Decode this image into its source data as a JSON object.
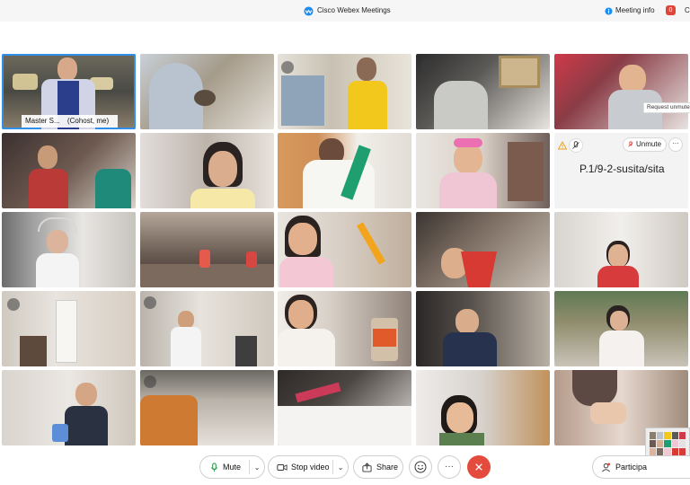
{
  "window": {
    "title": "Cisco Webex Meetings",
    "meeting_info_label": "Meeting info",
    "notification_count": "0",
    "edge_text": "C"
  },
  "self_tile": {
    "name": "Master S...",
    "role": "(Cohost, me)"
  },
  "audio_only_tile": {
    "unmute_label": "Unmute",
    "more_label": "···",
    "participant_name": "P.1/9-2-susita/sita",
    "tooltip": "Request unmute"
  },
  "controls": {
    "mute_label": "Mute",
    "stop_video_label": "Stop video",
    "share_label": "Share",
    "participants_label": "Participa",
    "end_color": "#e54b3c"
  },
  "colors": {
    "selected_outline": "#2f8fe9",
    "webex_blue": "#1d8df0"
  }
}
